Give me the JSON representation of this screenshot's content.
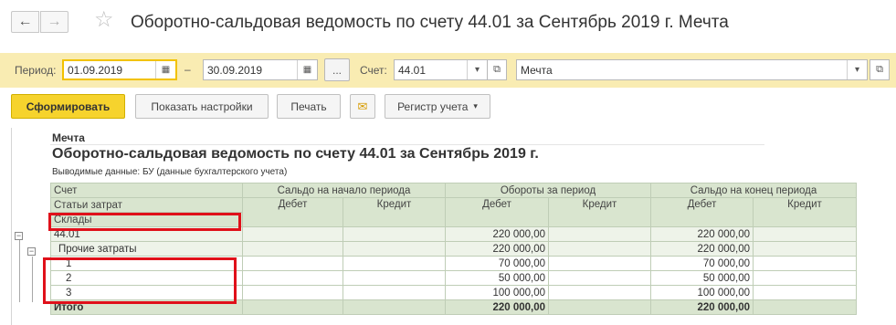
{
  "window": {
    "title": "Оборотно-сальдовая ведомость по счету 44.01 за Сентябрь 2019 г. Мечта",
    "back_glyph": "←",
    "forward_glyph": "→",
    "star_glyph": "☆"
  },
  "filters": {
    "period_label": "Период:",
    "date_from": "01.09.2019",
    "date_to": "30.09.2019",
    "dash": "–",
    "dots": "...",
    "account_label": "Счет:",
    "account_value": "44.01",
    "org_value": "Мечта"
  },
  "toolbar": {
    "generate": "Сформировать",
    "settings": "Показать настройки",
    "print": "Печать",
    "register": "Регистр учета"
  },
  "report": {
    "organization": "Мечта",
    "title": "Оборотно-сальдовая ведомость по счету 44.01 за Сентябрь 2019 г.",
    "note": "Выводимые данные:  БУ (данные бухгалтерского учета)",
    "header": {
      "account": "Счет",
      "cost_items": "Статьи затрат",
      "warehouses": "Склады",
      "opening": "Сальдо на начало периода",
      "turnover": "Обороты за период",
      "closing": "Сальдо на конец периода",
      "debit": "Дебет",
      "credit": "Кредит"
    },
    "rows": [
      {
        "label": "44.01",
        "open_debit": "",
        "open_credit": "",
        "turn_debit": "220 000,00",
        "turn_credit": "",
        "close_debit": "220 000,00",
        "close_credit": ""
      },
      {
        "label": "Прочие затраты",
        "open_debit": "",
        "open_credit": "",
        "turn_debit": "220 000,00",
        "turn_credit": "",
        "close_debit": "220 000,00",
        "close_credit": ""
      },
      {
        "label": "1",
        "open_debit": "",
        "open_credit": "",
        "turn_debit": "70 000,00",
        "turn_credit": "",
        "close_debit": "70 000,00",
        "close_credit": ""
      },
      {
        "label": "2",
        "open_debit": "",
        "open_credit": "",
        "turn_debit": "50 000,00",
        "turn_credit": "",
        "close_debit": "50 000,00",
        "close_credit": ""
      },
      {
        "label": "3",
        "open_debit": "",
        "open_credit": "",
        "turn_debit": "100 000,00",
        "turn_credit": "",
        "close_debit": "100 000,00",
        "close_credit": ""
      }
    ],
    "total": {
      "label": "Итого",
      "open_debit": "",
      "open_credit": "",
      "turn_debit": "220 000,00",
      "turn_credit": "",
      "close_debit": "220 000,00",
      "close_credit": ""
    }
  },
  "colors": {
    "filter_panel": "#f9ecb2",
    "primary_button": "#f6d32d",
    "header_fill": "#d9e5cf",
    "highlight_box": "#e0101a"
  }
}
